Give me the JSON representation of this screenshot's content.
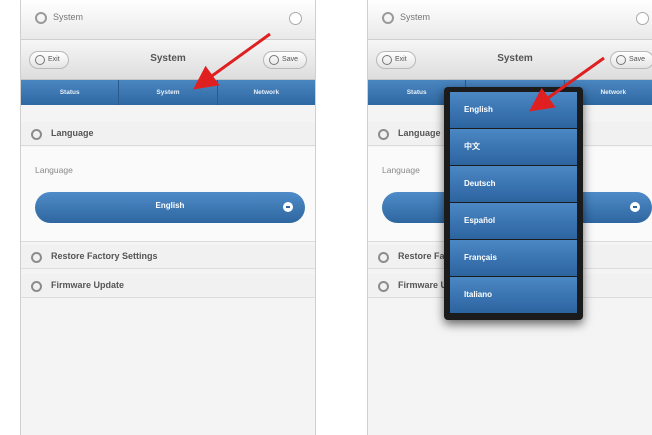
{
  "left": {
    "top_title": "System",
    "exit_label": "Exit",
    "title": "System",
    "save_label": "Save",
    "tabs": [
      "Status",
      "System",
      "Network"
    ],
    "sections": {
      "language": "Language",
      "restore": "Restore Factory Settings",
      "firmware": "Firmware Update"
    },
    "language_field_label": "Language",
    "language_value": "English"
  },
  "right": {
    "top_title": "System",
    "exit_label": "Exit",
    "title": "System",
    "save_label": "Save",
    "tabs": [
      "Status",
      "System",
      "Network"
    ],
    "sections": {
      "language": "Language",
      "restore": "Restore Factory Settings",
      "firmware": "Firmware Update"
    },
    "language_field_label": "Language",
    "language_options": [
      "English",
      "中文",
      "Deutsch",
      "Español",
      "Français",
      "Italiano"
    ]
  },
  "colors": {
    "accent_blue": "#3a76b2",
    "arrow_red": "#e02020"
  },
  "icons": {
    "gear": "gear-icon",
    "close_circle": "close-icon",
    "save": "save-icon",
    "section": "expand-icon",
    "dropdown": "chevron-down-icon"
  }
}
